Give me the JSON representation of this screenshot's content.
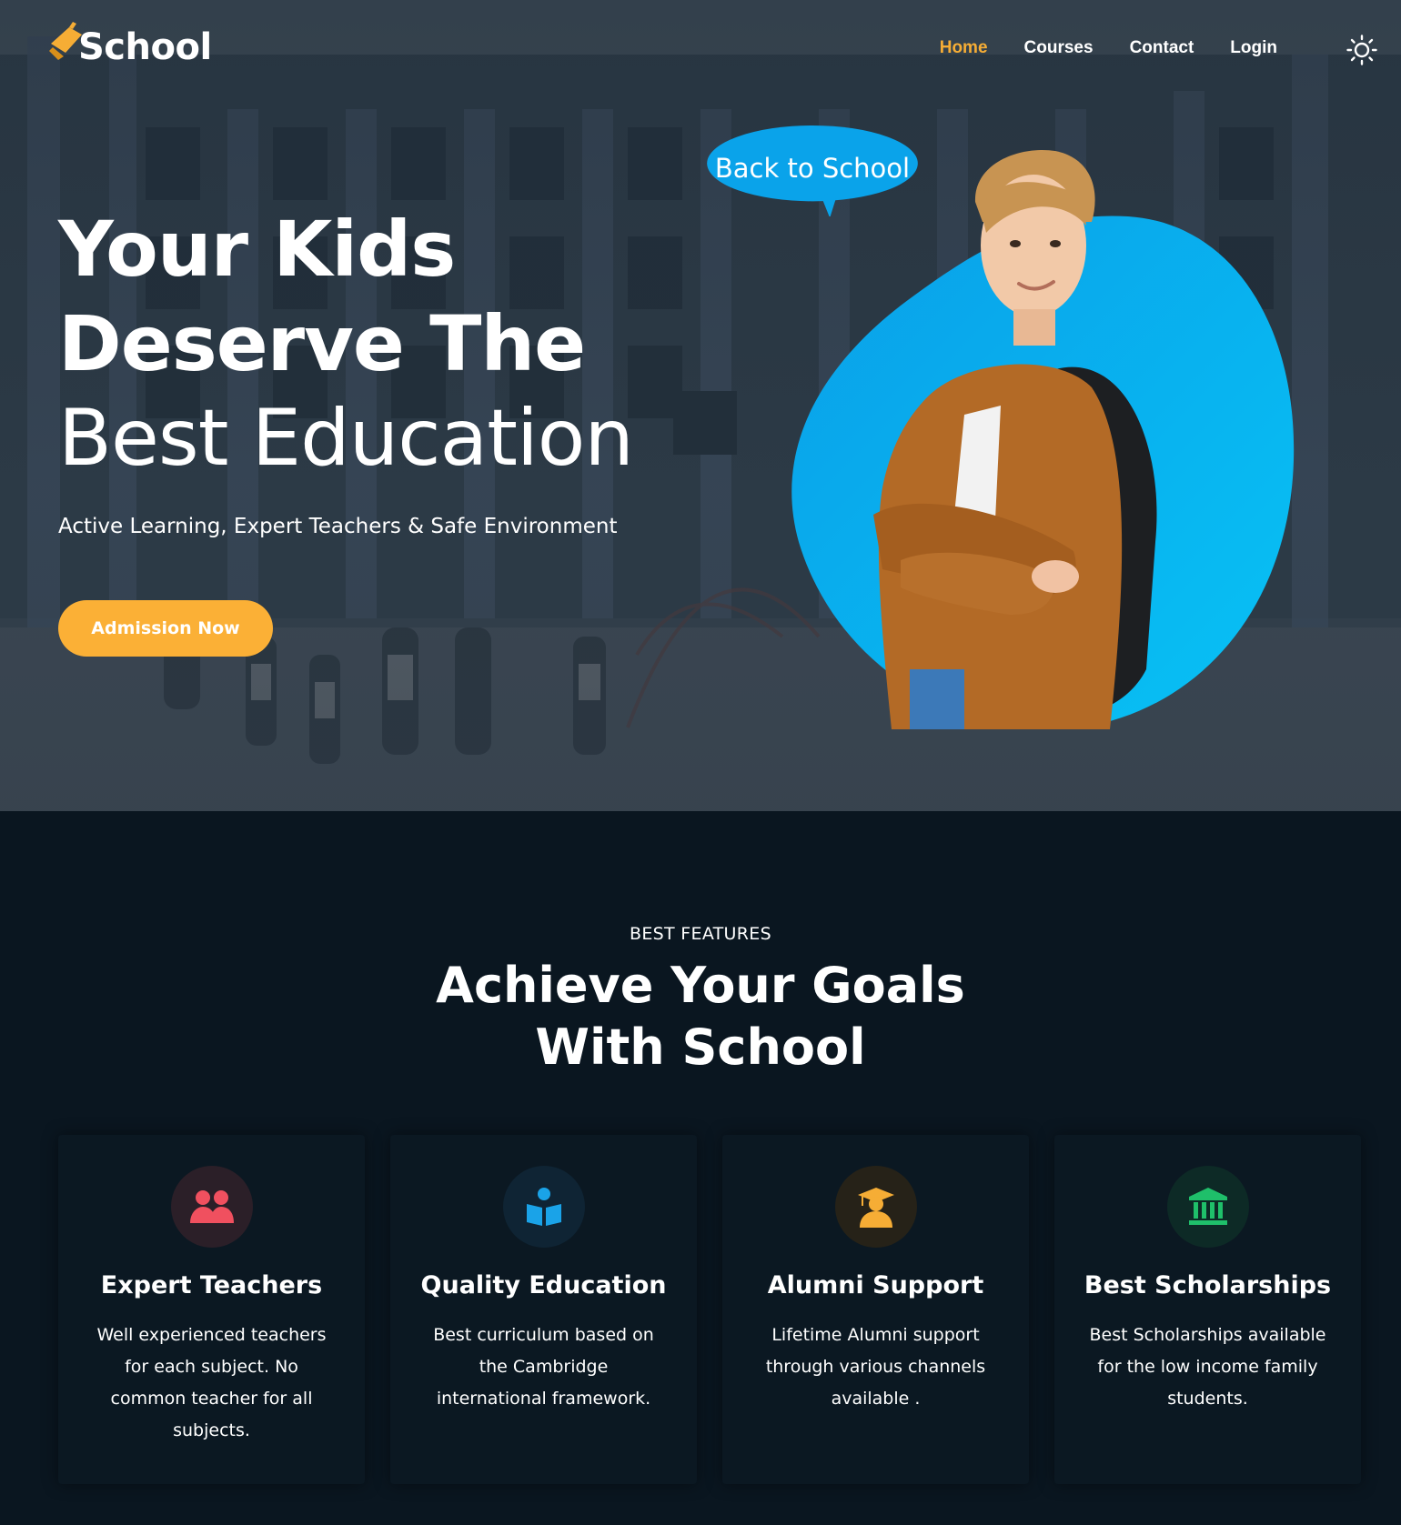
{
  "header": {
    "logo_text": "School",
    "nav": [
      {
        "label": "Home",
        "active": true
      },
      {
        "label": "Courses",
        "active": false
      },
      {
        "label": "Contact",
        "active": false
      },
      {
        "label": "Login",
        "active": false
      }
    ],
    "theme_toggle_icon": "sun-icon"
  },
  "hero": {
    "title_line1": "Your Kids",
    "title_line2": "Deserve The",
    "title_line3": "Best Education",
    "subtitle": "Active Learning, Expert Teachers & Safe Environment",
    "cta_label": "Admission Now",
    "bubble_text": "Back to School"
  },
  "features": {
    "eyebrow": "BEST FEATURES",
    "title_line1": "Achieve Your Goals",
    "title_line2": "With School",
    "cards": [
      {
        "title": "Expert Teachers",
        "desc": "Well experienced teachers for each subject. No common teacher for all subjects.",
        "icon": "users-icon",
        "color": "#f0505f"
      },
      {
        "title": "Quality Education",
        "desc": "Best curriculum based on the Cambridge international framework.",
        "icon": "book-reader-icon",
        "color": "#1aa3e8"
      },
      {
        "title": "Alumni Support",
        "desc": "Lifetime Alumni support through various channels available .",
        "icon": "graduate-icon",
        "color": "#f6ad35"
      },
      {
        "title": "Best Scholarships",
        "desc": "Best Scholarships available for the low income family students.",
        "icon": "university-icon",
        "color": "#1fbf6a"
      }
    ]
  },
  "colors": {
    "accent": "#f6ad35",
    "primary_blue": "#06aef0",
    "dark_bg": "#0a1620"
  }
}
